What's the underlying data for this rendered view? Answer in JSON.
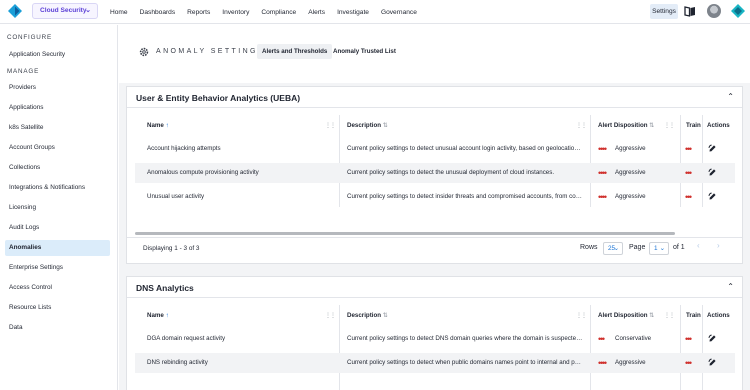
{
  "topbar": {
    "product": "Cloud Security",
    "nav": [
      "Home",
      "Dashboards",
      "Reports",
      "Inventory",
      "Compliance",
      "Alerts",
      "Investigate",
      "Governance"
    ],
    "settings": "Settings",
    "colors": {
      "brand": "#5b3fd6",
      "accent": "#1a74d6",
      "logo": "#1a9fd8"
    }
  },
  "sidebar": {
    "configure_heading": "CONFIGURE",
    "configure_items": [
      "Application Security"
    ],
    "manage_heading": "MANAGE",
    "manage_items": [
      "Providers",
      "Applications",
      "k8s Satellite",
      "Account Groups",
      "Collections",
      "Integrations & Notifications",
      "Licensing",
      "Audit Logs",
      "Anomalies",
      "Enterprise Settings",
      "Access Control",
      "Resource Lists",
      "Data"
    ],
    "active": "Anomalies"
  },
  "page": {
    "title": "ANOMALY SETTINGS",
    "tabs": [
      "Alerts and Thresholds",
      "Anomaly Trusted List"
    ],
    "active_tab": "Alerts and Thresholds"
  },
  "columns": {
    "name": "Name",
    "description": "Description",
    "alert_disposition": "Alert Disposition",
    "training": "Train",
    "actions": "Actions"
  },
  "ueba": {
    "title": "User & Entity Behavior Analytics (UEBA)",
    "rows": [
      {
        "name": "Account hijacking attempts",
        "description": "Current policy settings to detect unusual account login activity, based on geolocation of ...",
        "disposition": "Aggressive"
      },
      {
        "name": "Anomalous compute provisioning activity",
        "description": "Current policy settings to detect the unusual deployment of cloud instances.",
        "disposition": "Aggressive"
      },
      {
        "name": "Unusual user activity",
        "description": "Current policy settings to detect insider threats and compromised accounts, from consol...",
        "disposition": "Aggressive"
      }
    ],
    "footer": {
      "displaying": "Displaying 1 - 3 of 3",
      "rows_label": "Rows",
      "rows_value": "25",
      "page_label": "Page",
      "page_value": "1",
      "of_label": "of 1"
    }
  },
  "dns": {
    "title": "DNS Analytics",
    "rows": [
      {
        "name": "DGA domain request activity",
        "description": "Current policy settings to detect DNS domain queries where the domain is suspected to ...",
        "disposition": "Conservative"
      },
      {
        "name": "DNS rebinding activity",
        "description": "Current policy settings to detect when public domains names point to internal and publi...",
        "disposition": "Aggressive"
      }
    ]
  }
}
